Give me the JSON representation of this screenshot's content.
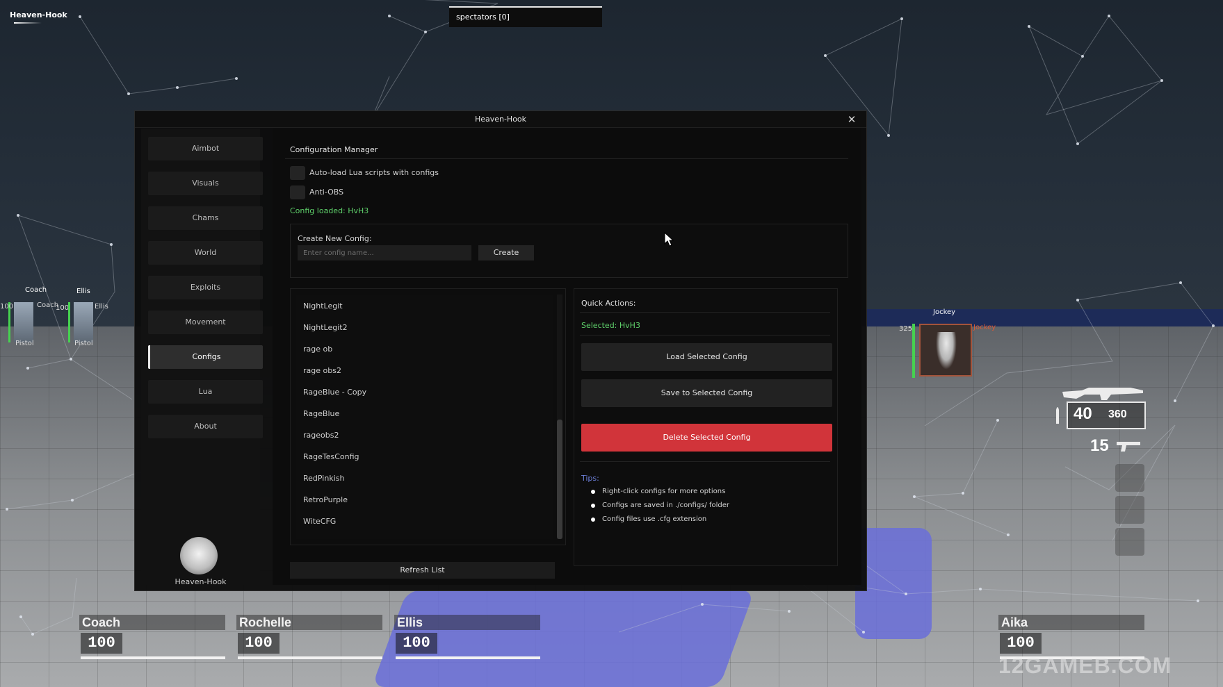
{
  "overlay": {
    "watermark": "Heaven-Hook",
    "spectators": "spectators [0]"
  },
  "window": {
    "title": "Heaven-Hook",
    "close_icon": "close-icon"
  },
  "sidebar": {
    "items": [
      {
        "label": "Aimbot"
      },
      {
        "label": "Visuals"
      },
      {
        "label": "Chams"
      },
      {
        "label": "World"
      },
      {
        "label": "Exploits"
      },
      {
        "label": "Movement"
      },
      {
        "label": "Configs",
        "active": true
      },
      {
        "label": "Lua"
      },
      {
        "label": "About"
      }
    ],
    "logo_label": "Heaven-Hook"
  },
  "main": {
    "title": "Configuration Manager",
    "options": [
      {
        "label": "Auto-load Lua scripts with configs",
        "checked": false
      },
      {
        "label": "Anti-OBS",
        "checked": false
      }
    ],
    "status": "Config loaded: HvH3",
    "create": {
      "label": "Create New Config:",
      "placeholder": "Enter config name...",
      "button": "Create"
    },
    "configs": [
      "NightLegit",
      "NightLegit2",
      "rage ob",
      "rage obs2",
      "RageBlue - Copy",
      "RageBlue",
      "rageobs2",
      "RageTesConfig",
      "RedPinkish",
      "RetroPurple",
      "WiteCFG"
    ],
    "refresh_button": "Refresh List",
    "quick_actions": {
      "title": "Quick Actions:",
      "selected": "Selected: HvH3",
      "load": "Load Selected Config",
      "save": "Save to Selected Config",
      "delete": "Delete Selected Config",
      "tips_title": "Tips:",
      "tips": [
        "Right-click configs for more options",
        "Configs are saved in ./configs/ folder",
        "Config files use .cfg extension"
      ]
    }
  },
  "hud": {
    "team": [
      {
        "name": "Coach",
        "hp": "100"
      },
      {
        "name": "Rochelle",
        "hp": "100"
      },
      {
        "name": "Ellis",
        "hp": "100"
      },
      {
        "name": "Aika",
        "hp": "100"
      }
    ],
    "side_players": {
      "coach_label": "Coach",
      "coach_tag": "Coach",
      "coach_weapon": "Pistol",
      "coach_hp": "100",
      "ellis_label": "Ellis",
      "ellis_tag": "Ellis",
      "ellis_weapon": "Pistol",
      "ellis_hp": "100"
    },
    "enemy": {
      "name": "Jockey",
      "tag": "Jockey",
      "hp": "325"
    },
    "ammo": {
      "clip": "40",
      "reserve": "360",
      "secondary": "15"
    },
    "site_watermark": "12GAMEB.COM",
    "colors": {
      "accent_green": "#5fd16b",
      "danger_red": "#d1343a",
      "tips_blue": "#6c7fd8"
    }
  }
}
